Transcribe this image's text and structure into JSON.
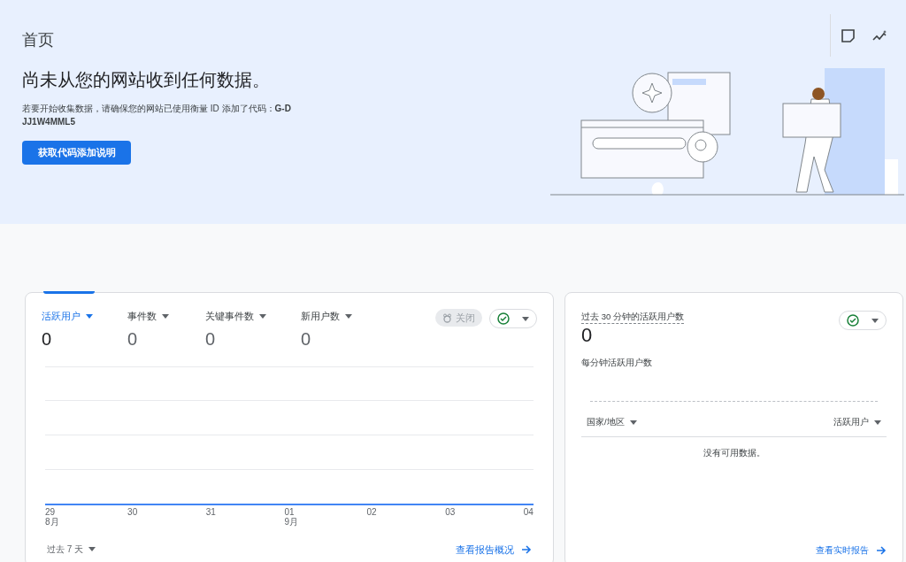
{
  "header": {
    "title": "首页",
    "heading": "尚未从您的网站收到任何数据。",
    "description": "若要开始收集数据，请确保您的网站已使用衡量 ID 添加了代码：**G-DJJ1W4MML5**",
    "button": "获取代码添加说明"
  },
  "overview_card": {
    "metrics": [
      {
        "label": "活跃用户",
        "value": "0",
        "selected": true
      },
      {
        "label": "事件数",
        "value": "0",
        "selected": false
      },
      {
        "label": "关键事件数",
        "value": "0",
        "selected": false
      },
      {
        "label": "新用户数",
        "value": "0",
        "selected": false
      }
    ],
    "insights_button": {
      "label": "关闭",
      "disabled": true
    },
    "x_labels": [
      {
        "day": "29",
        "month": "8月"
      },
      {
        "day": "30"
      },
      {
        "day": "31"
      },
      {
        "day": "01",
        "month": "9月"
      },
      {
        "day": "02"
      },
      {
        "day": "03"
      },
      {
        "day": "04"
      }
    ],
    "date_range": "过去 7 天",
    "link": "查看报告概况"
  },
  "realtime_card": {
    "title": "过去 30 分钟的活跃用户数",
    "value": "0",
    "subtitle": "每分钟活跃用户数",
    "columns": [
      "国家/地区",
      "活跃用户"
    ],
    "empty": "没有可用数据。",
    "link": "查看实时报告"
  }
}
